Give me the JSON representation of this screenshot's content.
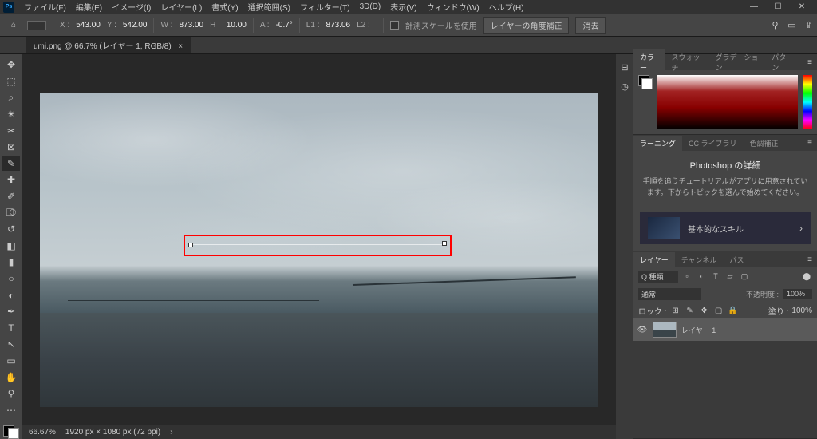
{
  "app_logo_text": "Ps",
  "menu": [
    "ファイル(F)",
    "編集(E)",
    "イメージ(I)",
    "レイヤー(L)",
    "書式(Y)",
    "選択範囲(S)",
    "フィルター(T)",
    "3D(D)",
    "表示(V)",
    "ウィンドウ(W)",
    "ヘルプ(H)"
  ],
  "options": {
    "x_label": "X :",
    "x": "543.00",
    "y_label": "Y :",
    "y": "542.00",
    "w_label": "W :",
    "w": "873.00",
    "h_label": "H :",
    "h": "10.00",
    "a_label": "A :",
    "a": "-0.7°",
    "l1_label": "L1 :",
    "l1": "873.06",
    "l2_label": "L2 :",
    "l2": "",
    "scale_label": "計測スケールを使用",
    "angle_btn": "レイヤーの角度補正",
    "clear_btn": "消去"
  },
  "tab": {
    "title": "umi.png @ 66.7% (レイヤー 1, RGB/8)",
    "close": "×"
  },
  "status": {
    "zoom": "66.67%",
    "dims": "1920 px × 1080 px (72 ppi)"
  },
  "panels": {
    "color": {
      "tabs": [
        "カラー",
        "スウォッチ",
        "グラデーション",
        "パターン"
      ]
    },
    "learn": {
      "tabs": [
        "ラーニング",
        "CC ライブラリ",
        "色調補正"
      ],
      "title": "Photoshop の詳細",
      "desc": "手順を追うチュートリアルがアプリに用意されています。下からトピックを選んで始めてください。",
      "item": "基本的なスキル",
      "arrow": "›"
    },
    "layers": {
      "tabs": [
        "レイヤー",
        "チャンネル",
        "パス"
      ],
      "filter_sel": "Q 種類",
      "blend": "通常",
      "opacity_label": "不透明度 :",
      "opacity": "100%",
      "lock_label": "ロック :",
      "fill_label": "塗り :",
      "fill": "100%",
      "layer_name": "レイヤー 1"
    }
  }
}
